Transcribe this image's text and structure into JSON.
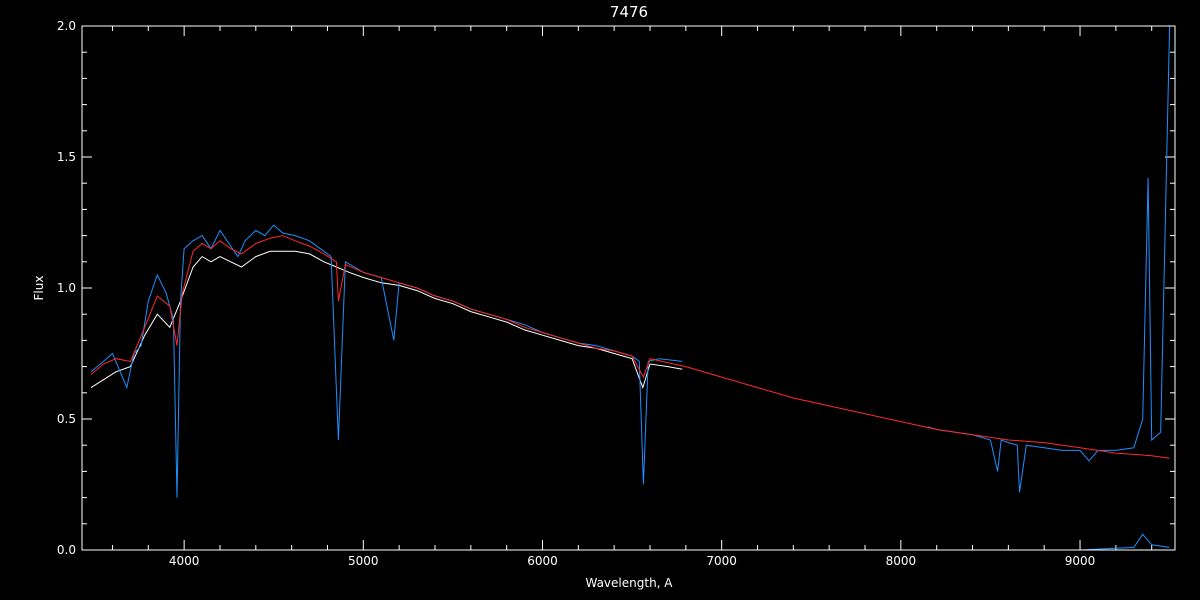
{
  "chart_data": {
    "type": "line",
    "title": "7476",
    "xlabel": "Wavelength, A",
    "ylabel": "Flux",
    "xlim": [
      3430,
      9530
    ],
    "ylim": [
      0.0,
      2.0
    ],
    "xticks": [
      4000,
      5000,
      6000,
      7000,
      8000,
      9000
    ],
    "xtick_labels": [
      "4000",
      "5000",
      "6000",
      "7000",
      "8000",
      "9000"
    ],
    "yticks": [
      0.0,
      0.5,
      1.0,
      1.5,
      2.0
    ],
    "ytick_labels": [
      "0.0",
      "0.5",
      "1.0",
      "1.5",
      "2.0"
    ],
    "grid": false,
    "series": [
      {
        "color": "#ffffff",
        "x": [
          3480,
          3550,
          3620,
          3700,
          3780,
          3850,
          3920,
          3980,
          4050,
          4100,
          4150,
          4200,
          4260,
          4320,
          4400,
          4480,
          4550,
          4620,
          4700,
          4780,
          4850,
          4920,
          5000,
          5100,
          5200,
          5300,
          5400,
          5500,
          5600,
          5700,
          5800,
          5900,
          6000,
          6100,
          6200,
          6300,
          6400,
          6500,
          6560,
          6600,
          6700,
          6780
        ],
        "y": [
          0.62,
          0.65,
          0.68,
          0.7,
          0.82,
          0.9,
          0.85,
          0.95,
          1.08,
          1.12,
          1.1,
          1.12,
          1.1,
          1.08,
          1.12,
          1.14,
          1.14,
          1.14,
          1.13,
          1.1,
          1.08,
          1.06,
          1.04,
          1.02,
          1.01,
          0.99,
          0.96,
          0.94,
          0.91,
          0.89,
          0.87,
          0.84,
          0.82,
          0.8,
          0.78,
          0.77,
          0.75,
          0.73,
          0.62,
          0.71,
          0.7,
          0.69
        ]
      },
      {
        "color": "#1e90ff",
        "x": [
          3480,
          3550,
          3600,
          3680,
          3720,
          3760,
          3800,
          3850,
          3900,
          3940,
          3960,
          3980,
          4000,
          4050,
          4100,
          4150,
          4200,
          4260,
          4300,
          4340,
          4400,
          4450,
          4500,
          4550,
          4620,
          4700,
          4780,
          4820,
          4861,
          4900,
          4950,
          5000,
          5100,
          5170,
          5200,
          5300,
          5400,
          5500,
          5600,
          5700,
          5800,
          5900,
          6000,
          6100,
          6200,
          6300,
          6400,
          6500,
          6540,
          6563,
          6590,
          6650,
          6780
        ],
        "y": [
          0.68,
          0.72,
          0.75,
          0.62,
          0.75,
          0.78,
          0.95,
          1.05,
          0.98,
          0.88,
          0.2,
          0.95,
          1.15,
          1.18,
          1.2,
          1.15,
          1.22,
          1.16,
          1.12,
          1.18,
          1.22,
          1.2,
          1.24,
          1.21,
          1.2,
          1.18,
          1.14,
          1.12,
          0.42,
          1.1,
          1.08,
          1.06,
          1.04,
          0.8,
          1.02,
          1.0,
          0.97,
          0.95,
          0.92,
          0.9,
          0.88,
          0.86,
          0.83,
          0.81,
          0.79,
          0.78,
          0.76,
          0.74,
          0.72,
          0.25,
          0.72,
          0.73,
          0.72
        ]
      },
      {
        "color": "#1e90ff",
        "x": [
          8150,
          8200,
          8300,
          8400,
          8500,
          8540,
          8560,
          8600,
          8650,
          8662,
          8700,
          8800,
          8900,
          9000,
          9050,
          9100,
          9200,
          9300,
          9350,
          9380,
          9400,
          9450,
          9500
        ],
        "y": [
          0.47,
          0.46,
          0.45,
          0.44,
          0.42,
          0.3,
          0.42,
          0.41,
          0.4,
          0.22,
          0.4,
          0.39,
          0.38,
          0.38,
          0.34,
          0.38,
          0.38,
          0.39,
          0.5,
          1.42,
          0.42,
          0.45,
          2.0
        ]
      },
      {
        "color": "#ff2a2a",
        "x": [
          3480,
          3550,
          3620,
          3700,
          3780,
          3850,
          3920,
          3960,
          3990,
          4050,
          4100,
          4150,
          4200,
          4260,
          4320,
          4400,
          4480,
          4550,
          4620,
          4700,
          4780,
          4850,
          4861,
          4900,
          5000,
          5100,
          5200,
          5300,
          5400,
          5500,
          5600,
          5700,
          5800,
          5900,
          6000,
          6100,
          6200,
          6300,
          6400,
          6500,
          6563,
          6600,
          6800,
          7000,
          7200,
          7400,
          7600,
          7800,
          8000,
          8200,
          8400,
          8600,
          8800,
          9000,
          9200,
          9400,
          9500
        ],
        "y": [
          0.67,
          0.71,
          0.73,
          0.72,
          0.85,
          0.97,
          0.93,
          0.78,
          0.98,
          1.14,
          1.17,
          1.15,
          1.18,
          1.15,
          1.13,
          1.17,
          1.19,
          1.2,
          1.18,
          1.16,
          1.13,
          1.1,
          0.95,
          1.09,
          1.06,
          1.04,
          1.02,
          1.0,
          0.97,
          0.95,
          0.92,
          0.9,
          0.88,
          0.85,
          0.83,
          0.81,
          0.79,
          0.77,
          0.76,
          0.74,
          0.66,
          0.73,
          0.7,
          0.66,
          0.62,
          0.58,
          0.55,
          0.52,
          0.49,
          0.46,
          0.44,
          0.42,
          0.41,
          0.39,
          0.37,
          0.36,
          0.35
        ]
      },
      {
        "color": "#1e90ff",
        "x": [
          3480,
          5000,
          7000,
          9000,
          9300,
          9350,
          9400,
          9500
        ],
        "y": [
          0.0,
          0.0,
          0.0,
          0.0,
          0.01,
          0.06,
          0.02,
          0.01
        ]
      }
    ]
  }
}
